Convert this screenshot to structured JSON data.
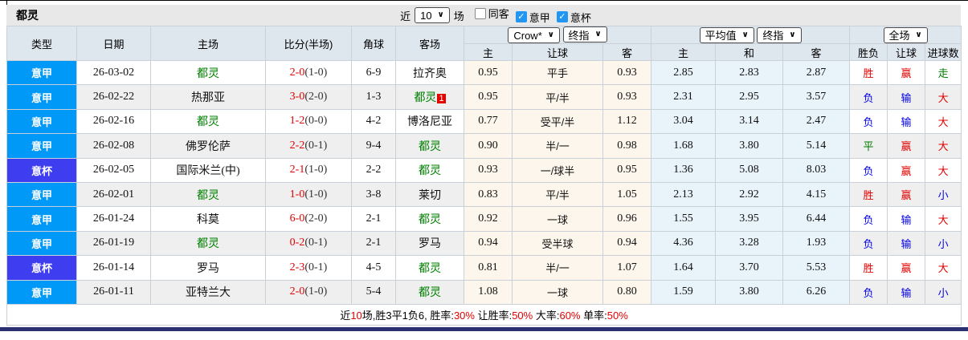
{
  "toolbar": {
    "team": "都灵",
    "recent_label": "近",
    "count_value": "10",
    "matches_label": "场",
    "checkboxes": [
      {
        "label": "同客",
        "checked": false
      },
      {
        "label": "意甲",
        "checked": true
      },
      {
        "label": "意杯",
        "checked": true
      }
    ]
  },
  "colors": {
    "league_badge": "#0099f7",
    "cup_badge": "#3e3ef0",
    "win_red": "#e50000",
    "lose_blue": "#0000e6",
    "draw_green": "#007a00",
    "odds_bg": "#fdf6ec",
    "avg_bg": "#e9f3fa",
    "header_bg": "#dee6ee",
    "toolbar_bg": "#e8e8e8",
    "bottom_bar": "#2b3173"
  },
  "header": {
    "main_columns": [
      "类型",
      "日期",
      "主场",
      "比分(半场)",
      "角球",
      "客场"
    ],
    "odds_group": {
      "selects": [
        "Crow*",
        "终指"
      ],
      "columns": [
        "主",
        "让球",
        "客"
      ]
    },
    "avg_group": {
      "selects": [
        "平均值",
        "终指"
      ],
      "columns": [
        "主",
        "和",
        "客"
      ]
    },
    "result_group": {
      "selects": [
        "全场"
      ],
      "columns": [
        "胜负",
        "让球",
        "进球数"
      ]
    }
  },
  "rows": [
    {
      "type": "意甲",
      "cup": false,
      "date": "26-03-02",
      "home": "都灵",
      "home_green": true,
      "home_badge": "",
      "score": "2-0",
      "half": "(1-0)",
      "corners": "6-9",
      "away": "拉齐奥",
      "away_green": false,
      "away_badge": "",
      "o1": "0.95",
      "line": "平手",
      "o2": "0.93",
      "a1": "2.85",
      "a2": "2.83",
      "a3": "2.87",
      "res": "胜",
      "res_c": "red",
      "hcp": "赢",
      "hcp_c": "red",
      "goal": "走",
      "goal_c": "green"
    },
    {
      "type": "意甲",
      "cup": false,
      "date": "26-02-22",
      "home": "热那亚",
      "home_green": false,
      "home_badge": "",
      "score": "3-0",
      "half": "(2-0)",
      "corners": "1-3",
      "away": "都灵",
      "away_green": true,
      "away_badge": "1",
      "o1": "0.95",
      "line": "平/半",
      "o2": "0.93",
      "a1": "2.31",
      "a2": "2.95",
      "a3": "3.57",
      "res": "负",
      "res_c": "blue",
      "hcp": "输",
      "hcp_c": "blue",
      "goal": "大",
      "goal_c": "red"
    },
    {
      "type": "意甲",
      "cup": false,
      "date": "26-02-16",
      "home": "都灵",
      "home_green": true,
      "home_badge": "",
      "score": "1-2",
      "half": "(0-0)",
      "corners": "4-2",
      "away": "博洛尼亚",
      "away_green": false,
      "away_badge": "",
      "o1": "0.77",
      "line": "受平/半",
      "o2": "1.12",
      "a1": "3.04",
      "a2": "3.14",
      "a3": "2.47",
      "res": "负",
      "res_c": "blue",
      "hcp": "输",
      "hcp_c": "blue",
      "goal": "大",
      "goal_c": "red"
    },
    {
      "type": "意甲",
      "cup": false,
      "date": "26-02-08",
      "home": "佛罗伦萨",
      "home_green": false,
      "home_badge": "",
      "score": "2-2",
      "half": "(0-1)",
      "corners": "9-4",
      "away": "都灵",
      "away_green": true,
      "away_badge": "",
      "o1": "0.90",
      "line": "半/一",
      "o2": "0.98",
      "a1": "1.68",
      "a2": "3.80",
      "a3": "5.14",
      "res": "平",
      "res_c": "green",
      "hcp": "赢",
      "hcp_c": "red",
      "goal": "大",
      "goal_c": "red"
    },
    {
      "type": "意杯",
      "cup": true,
      "date": "26-02-05",
      "home": "国际米兰(中)",
      "home_green": false,
      "home_badge": "",
      "score": "2-1",
      "half": "(1-0)",
      "corners": "2-2",
      "away": "都灵",
      "away_green": true,
      "away_badge": "",
      "o1": "0.93",
      "line": "一/球半",
      "o2": "0.95",
      "a1": "1.36",
      "a2": "5.08",
      "a3": "8.03",
      "res": "负",
      "res_c": "blue",
      "hcp": "赢",
      "hcp_c": "red",
      "goal": "大",
      "goal_c": "red"
    },
    {
      "type": "意甲",
      "cup": false,
      "date": "26-02-01",
      "home": "都灵",
      "home_green": true,
      "home_badge": "",
      "score": "1-0",
      "half": "(1-0)",
      "corners": "3-8",
      "away": "莱切",
      "away_green": false,
      "away_badge": "",
      "o1": "0.83",
      "line": "平/半",
      "o2": "1.05",
      "a1": "2.13",
      "a2": "2.92",
      "a3": "4.15",
      "res": "胜",
      "res_c": "red",
      "hcp": "赢",
      "hcp_c": "red",
      "goal": "小",
      "goal_c": "blue"
    },
    {
      "type": "意甲",
      "cup": false,
      "date": "26-01-24",
      "home": "科莫",
      "home_green": false,
      "home_badge": "",
      "score": "6-0",
      "half": "(2-0)",
      "corners": "2-1",
      "away": "都灵",
      "away_green": true,
      "away_badge": "",
      "o1": "0.92",
      "line": "一球",
      "o2": "0.96",
      "a1": "1.55",
      "a2": "3.95",
      "a3": "6.44",
      "res": "负",
      "res_c": "blue",
      "hcp": "输",
      "hcp_c": "blue",
      "goal": "大",
      "goal_c": "red"
    },
    {
      "type": "意甲",
      "cup": false,
      "date": "26-01-19",
      "home": "都灵",
      "home_green": true,
      "home_badge": "",
      "score": "0-2",
      "half": "(0-1)",
      "corners": "2-1",
      "away": "罗马",
      "away_green": false,
      "away_badge": "",
      "o1": "0.94",
      "line": "受半球",
      "o2": "0.94",
      "a1": "4.36",
      "a2": "3.28",
      "a3": "1.93",
      "res": "负",
      "res_c": "blue",
      "hcp": "输",
      "hcp_c": "blue",
      "goal": "小",
      "goal_c": "blue"
    },
    {
      "type": "意杯",
      "cup": true,
      "date": "26-01-14",
      "home": "罗马",
      "home_green": false,
      "home_badge": "",
      "score": "2-3",
      "half": "(0-1)",
      "corners": "4-5",
      "away": "都灵",
      "away_green": true,
      "away_badge": "",
      "o1": "0.81",
      "line": "半/一",
      "o2": "1.07",
      "a1": "1.64",
      "a2": "3.70",
      "a3": "5.53",
      "res": "胜",
      "res_c": "red",
      "hcp": "赢",
      "hcp_c": "red",
      "goal": "大",
      "goal_c": "red"
    },
    {
      "type": "意甲",
      "cup": false,
      "date": "26-01-11",
      "home": "亚特兰大",
      "home_green": false,
      "home_badge": "",
      "score": "2-0",
      "half": "(1-0)",
      "corners": "5-4",
      "away": "都灵",
      "away_green": true,
      "away_badge": "",
      "o1": "1.08",
      "line": "一球",
      "o2": "0.80",
      "a1": "1.59",
      "a2": "3.80",
      "a3": "6.26",
      "res": "负",
      "res_c": "blue",
      "hcp": "输",
      "hcp_c": "blue",
      "goal": "小",
      "goal_c": "blue"
    }
  ],
  "footer": {
    "segments": [
      {
        "t": "近"
      },
      {
        "t": "10",
        "red": true
      },
      {
        "t": "场,胜3平1负6, 胜率:"
      },
      {
        "t": "30%",
        "red": true
      },
      {
        "t": " 让胜率:"
      },
      {
        "t": "50%",
        "red": true
      },
      {
        "t": " 大率:"
      },
      {
        "t": "60%",
        "red": true
      },
      {
        "t": " 单率:"
      },
      {
        "t": "50%",
        "red": true
      }
    ]
  }
}
